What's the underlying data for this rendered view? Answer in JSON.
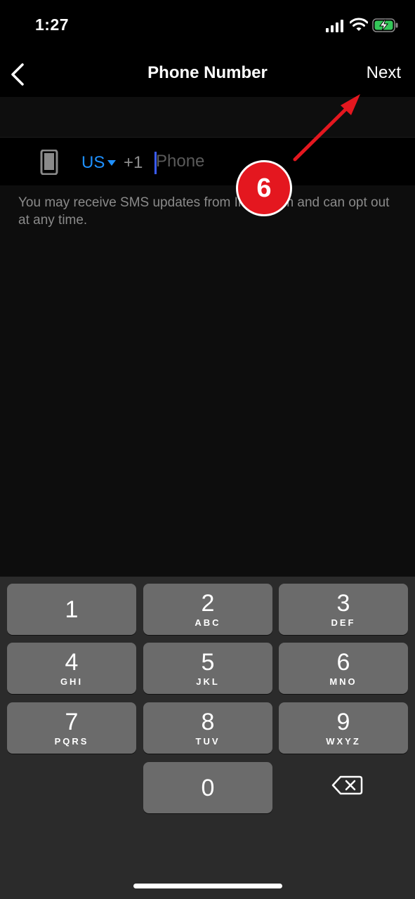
{
  "status_bar": {
    "time": "1:27"
  },
  "nav": {
    "title": "Phone Number",
    "next_label": "Next"
  },
  "phone": {
    "country": "US",
    "dial_code": "+1",
    "placeholder": "Phone",
    "value": ""
  },
  "info_text": "You may receive SMS updates from Instagram and can opt out at any time.",
  "annotation": {
    "step": "6",
    "color": "#e4171f"
  },
  "keypad": {
    "keys": [
      {
        "digit": "1",
        "letters": ""
      },
      {
        "digit": "2",
        "letters": "ABC"
      },
      {
        "digit": "3",
        "letters": "DEF"
      },
      {
        "digit": "4",
        "letters": "GHI"
      },
      {
        "digit": "5",
        "letters": "JKL"
      },
      {
        "digit": "6",
        "letters": "MNO"
      },
      {
        "digit": "7",
        "letters": "PQRS"
      },
      {
        "digit": "8",
        "letters": "TUV"
      },
      {
        "digit": "9",
        "letters": "WXYZ"
      },
      {
        "digit": "0",
        "letters": ""
      }
    ]
  },
  "colors": {
    "accent": "#1e90ff",
    "background": "#0d0d0d",
    "keypad_bg": "#2b2b2b",
    "key_bg": "#6b6b6b"
  }
}
